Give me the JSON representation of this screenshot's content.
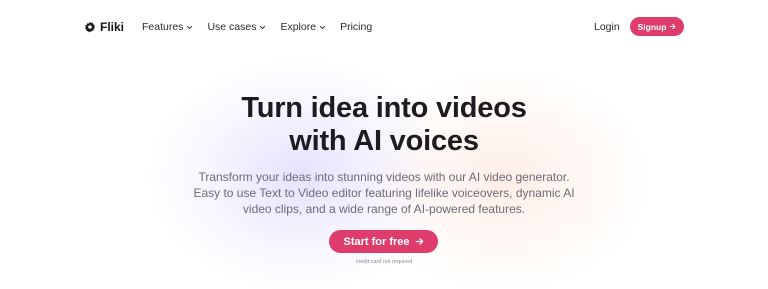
{
  "brand": {
    "name": "Fliki",
    "logo_icon": "gear-logo-icon"
  },
  "nav": {
    "items": [
      {
        "label": "Features",
        "has_dropdown": true
      },
      {
        "label": "Use cases",
        "has_dropdown": true
      },
      {
        "label": "Explore",
        "has_dropdown": true
      },
      {
        "label": "Pricing",
        "has_dropdown": false
      }
    ],
    "login_label": "Login",
    "signup_label": "Signup"
  },
  "hero": {
    "title_line1": "Turn idea into videos",
    "title_line2": "with AI voices",
    "subtitle": "Transform your ideas into stunning videos with our AI video generator. Easy to use Text to Video editor featuring lifelike voiceovers, dynamic AI video clips, and a wide range of AI-powered features.",
    "cta_label": "Start for free",
    "note": "credit card not required"
  },
  "colors": {
    "accent": "#de3d6b",
    "text": "#1b1b20",
    "muted": "#6b6b74"
  }
}
